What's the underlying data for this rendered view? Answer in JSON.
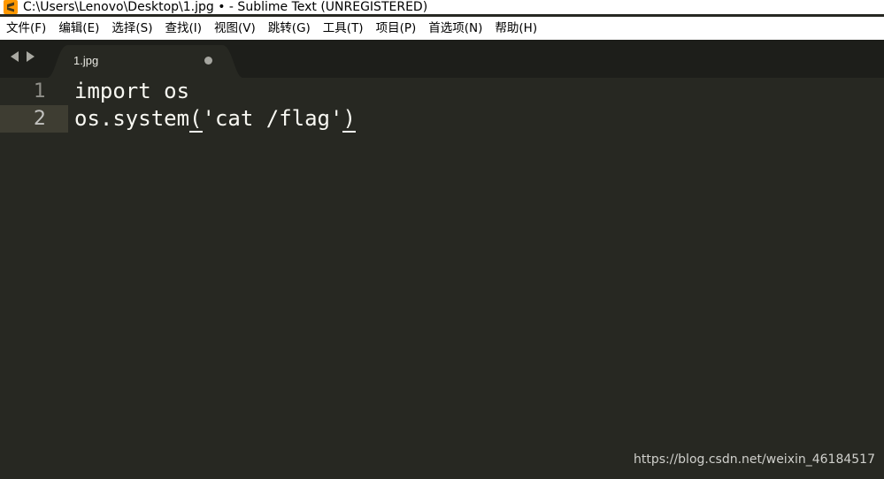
{
  "window": {
    "title": "C:\\Users\\Lenovo\\Desktop\\1.jpg • - Sublime Text (UNREGISTERED)",
    "app_icon": "sublime-text-icon"
  },
  "menu": [
    "文件(F)",
    "编辑(E)",
    "选择(S)",
    "查找(I)",
    "视图(V)",
    "跳转(G)",
    "工具(T)",
    "项目(P)",
    "首选项(N)",
    "帮助(H)"
  ],
  "tabs": [
    {
      "label": "1.jpg",
      "dirty": true,
      "active": true
    }
  ],
  "editor": {
    "current_line": 2,
    "lines": [
      {
        "number": "1",
        "pre": "import os",
        "open": "",
        "mid": "",
        "close": ""
      },
      {
        "number": "2",
        "pre": "os.system",
        "open": "(",
        "mid": "'cat /flag'",
        "close": ")"
      }
    ]
  },
  "watermark": "https://blog.csdn.net/weixin_46184517",
  "colors": {
    "editor_bg": "#272822",
    "tabbar_bg": "#1d1e1a",
    "active_tab": "#272822",
    "text": "#f8f8f2",
    "gutter_text": "#90908a",
    "line_highlight": "#3e3d32"
  }
}
